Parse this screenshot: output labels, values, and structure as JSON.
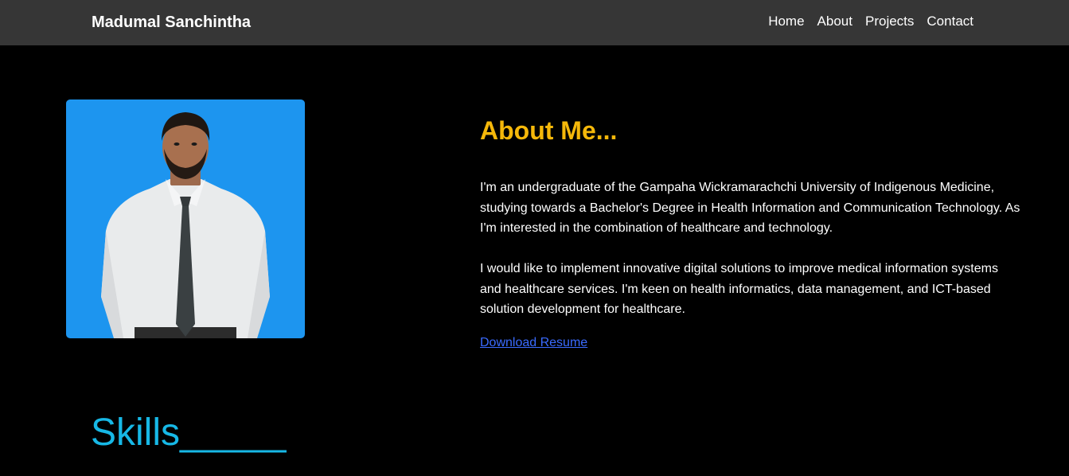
{
  "header": {
    "brand": "Madumal Sanchintha",
    "nav": [
      "Home",
      "About",
      "Projects",
      "Contact"
    ]
  },
  "about": {
    "heading": "About Me...",
    "paragraphs": [
      "I'm an undergraduate of the Gampaha Wickramarachchi University of Indigenous Medicine, studying towards a Bachelor's Degree in Health Information and Communication Technology. As I'm interested in the combination of healthcare and technology.",
      "I would like to implement innovative digital solutions to improve medical information systems and healthcare services. I'm keen on health informatics, data management, and ICT-based solution development for healthcare."
    ],
    "download_label": "Download Resume"
  },
  "skills": {
    "heading": "Skills_____"
  },
  "colors": {
    "nav_bg": "#363636",
    "page_bg": "#000000",
    "heading_accent": "#f5b80a",
    "skills_accent": "#17b8e6",
    "link": "#3a6bff",
    "photo_bg": "#1d95ef"
  }
}
